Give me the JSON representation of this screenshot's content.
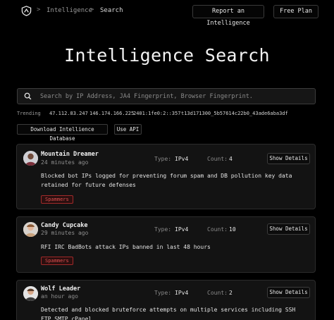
{
  "nav": {
    "crumbs": [
      "Intelligence",
      "Search"
    ],
    "separator": ">",
    "report_label": "Report an Intelligence",
    "plan_label": "Free Plan"
  },
  "page": {
    "title": "Intelligence Search"
  },
  "search": {
    "placeholder": "Search by IP Address, JA4 Fingerprint, Browser Fingerprint."
  },
  "trending": {
    "label": "Trending",
    "items": [
      "47.112.83.247",
      "146.174.166.225",
      "2401:1fe0:2::357",
      "t13d171300_5b57614c22b0_43ade6aba3df"
    ]
  },
  "actions": {
    "download_label": "Download Intellience Database",
    "api_label": "Use API"
  },
  "labels": {
    "type": "Type:",
    "count": "Count:",
    "details": "Show Details"
  },
  "cards": [
    {
      "name": "Mountain Dreamer",
      "time": "24 minutes ago",
      "type": "IPv4",
      "count": "4",
      "description": "Blocked bot IPs logged for preventing forum spam and DB pollution key data retained for future defenses",
      "tag": "Spammers",
      "avatar": "avatar-mountain-dreamer"
    },
    {
      "name": "Candy Cupcake",
      "time": "29 minutes ago",
      "type": "IPv4",
      "count": "10",
      "description": "RFI IRC BadBots attack IPs banned in last 48 hours",
      "tag": "Spammers",
      "avatar": "avatar-candy-cupcake"
    },
    {
      "name": "Wolf Leader",
      "time": "an hour ago",
      "type": "IPv4",
      "count": "2",
      "description": "Detected and blocked bruteforce attempts on multiple services including SSH FTP SMTP cPanel",
      "tag": "",
      "avatar": "avatar-wolf-leader"
    }
  ],
  "colors": {
    "background": "#000000",
    "card": "#131313",
    "border": "#2c2c2c",
    "tag_red": "#e05050"
  }
}
